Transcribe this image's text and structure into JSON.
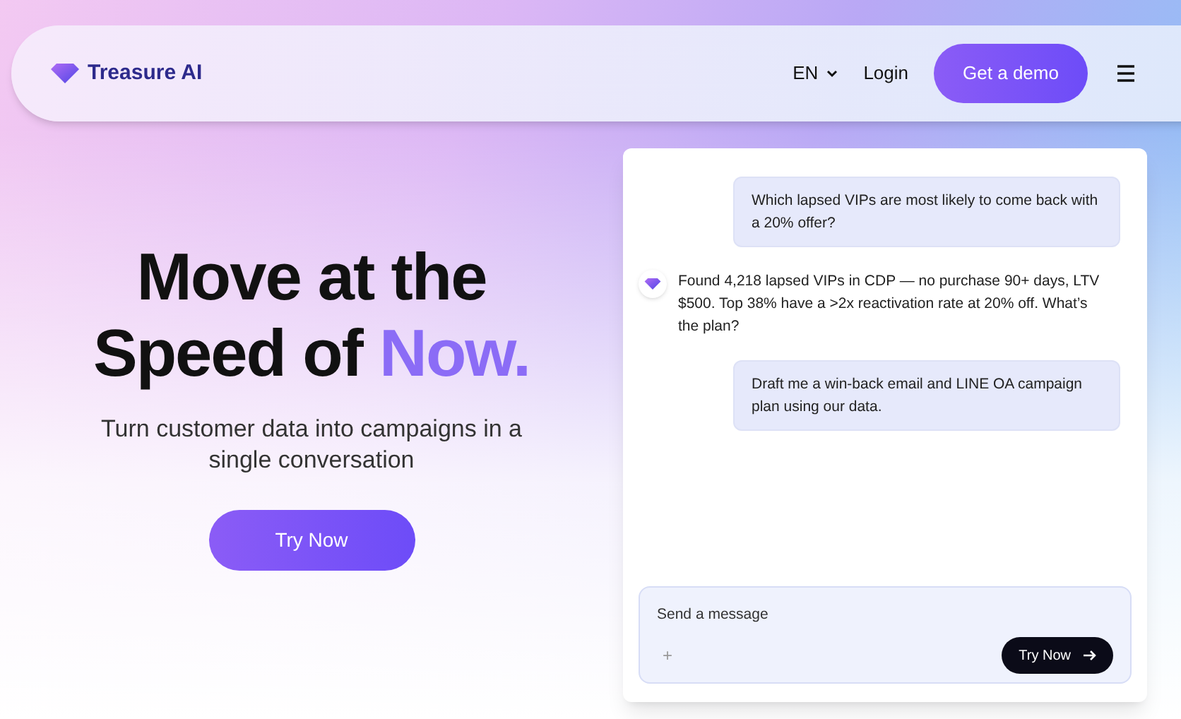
{
  "nav": {
    "brand": "Treasure AI",
    "language": "EN",
    "login": "Login",
    "cta": "Get a demo"
  },
  "hero": {
    "title_start": "Move at the",
    "title_line2": "Speed of",
    "title_highlight": "Now.",
    "subtitle": "Turn customer data into campaigns in a single conversation",
    "button": "Try Now"
  },
  "chat": {
    "messages": [
      {
        "kind": "user",
        "text": "Which lapsed VIPs are most likely to come back with a 20% offer?"
      },
      {
        "kind": "assistant",
        "text": "Found 4,218 lapsed VIPs in CDP — no purchase 90+ days, LTV $500. Top 38% have a >2x reactivation rate at 20% off. What’s the plan?"
      },
      {
        "kind": "user",
        "text": "Draft me a win-back email and LINE OA campaign plan using our data."
      }
    ],
    "input": {
      "placeholder": "Send a message",
      "add": "+",
      "button": "Try Now"
    }
  }
}
